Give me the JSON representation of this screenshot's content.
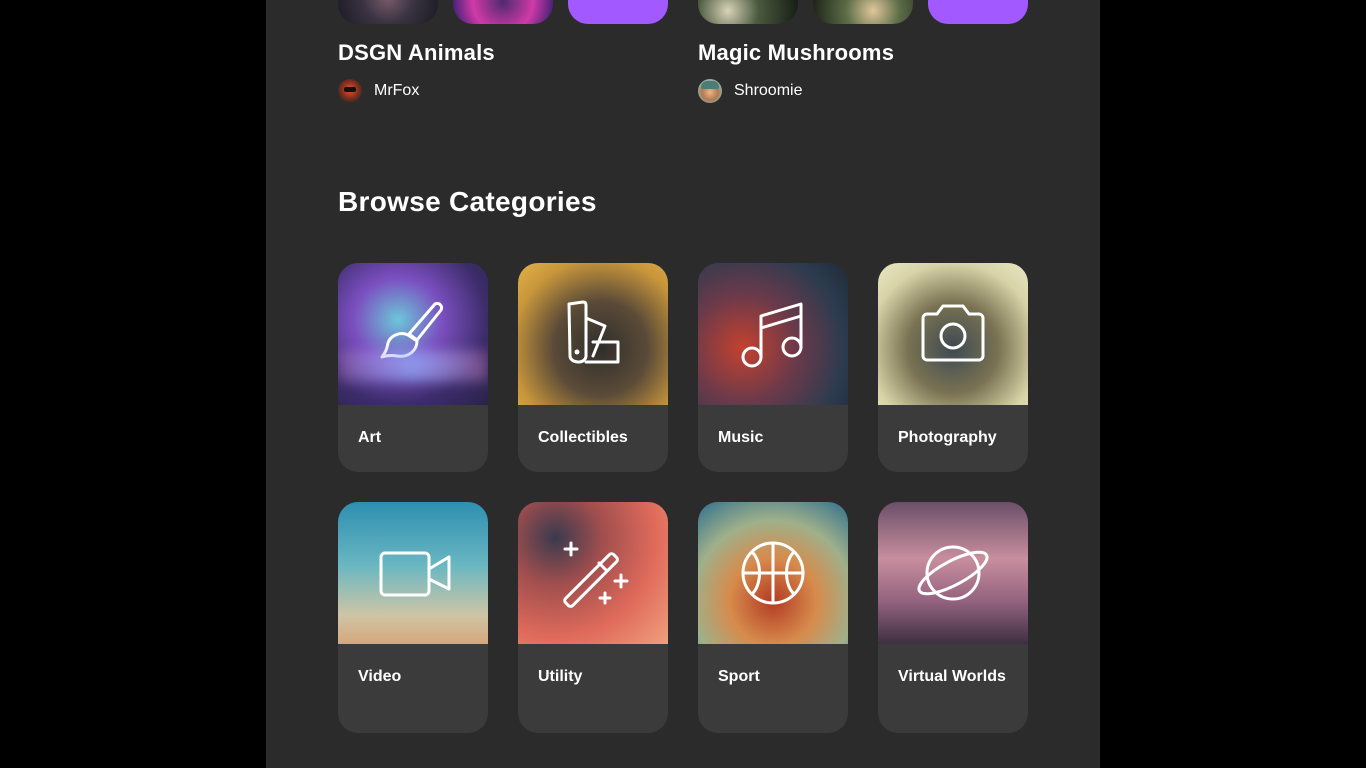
{
  "collections": [
    {
      "title": "DSGN Animals",
      "artist": {
        "name": "MrFox",
        "avatar_icon": "fox-avatar"
      }
    },
    {
      "title": "Magic Mushrooms",
      "artist": {
        "name": "Shroomie",
        "avatar_icon": "mushroom-avatar"
      }
    }
  ],
  "browse": {
    "title": "Browse Categories",
    "categories": [
      {
        "label": "Art",
        "icon": "paint-brush-icon"
      },
      {
        "label": "Collectibles",
        "icon": "swatches-icon"
      },
      {
        "label": "Music",
        "icon": "music-notes-icon"
      },
      {
        "label": "Photography",
        "icon": "camera-icon"
      },
      {
        "label": "Video",
        "icon": "video-camera-icon"
      },
      {
        "label": "Utility",
        "icon": "magic-wand-icon"
      },
      {
        "label": "Sport",
        "icon": "basketball-icon"
      },
      {
        "label": "Virtual Worlds",
        "icon": "planet-icon"
      }
    ]
  },
  "colors": {
    "page_bg": "#2b2b2b",
    "card_bg": "#3b3b3b",
    "accent": "#a259ff",
    "outer_bg": "#000000"
  }
}
